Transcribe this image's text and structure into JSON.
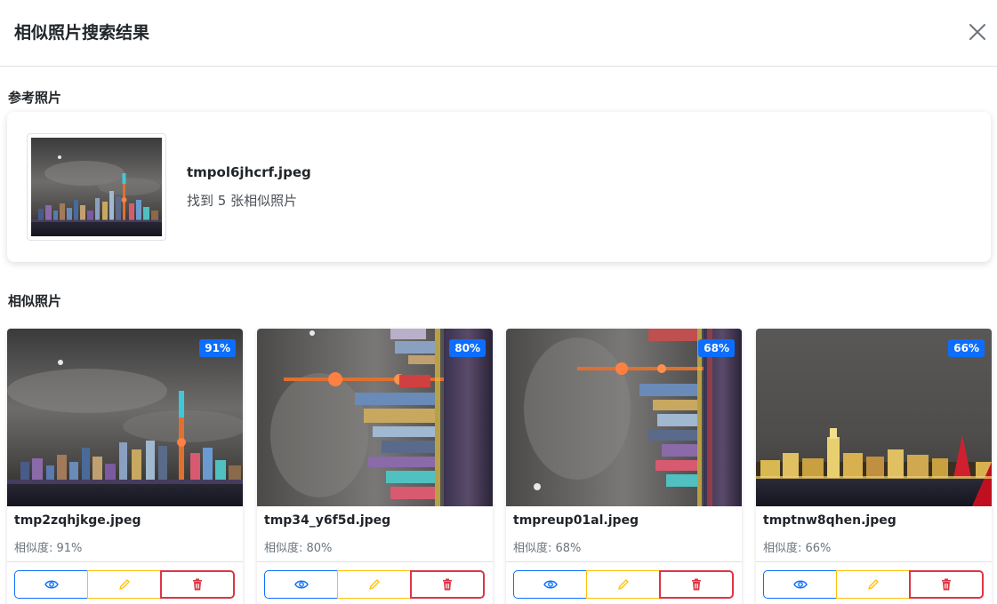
{
  "modal": {
    "title": "相似照片搜索结果",
    "close_icon": "close-icon"
  },
  "reference": {
    "section_title": "参考照片",
    "filename": "tmpol6jhcrf.jpeg",
    "count_text": "找到 5 张相似照片"
  },
  "similar": {
    "section_title": "相似照片",
    "items": [
      {
        "filename": "tmp2zqhjkge.jpeg",
        "badge": "91%",
        "similarity": "相似度: 91%"
      },
      {
        "filename": "tmp34_y6f5d.jpeg",
        "badge": "80%",
        "similarity": "相似度: 80%"
      },
      {
        "filename": "tmpreup01al.jpeg",
        "badge": "68%",
        "similarity": "相似度: 68%"
      },
      {
        "filename": "tmptnw8qhen.jpeg",
        "badge": "66%",
        "similarity": "相似度: 66%"
      }
    ],
    "actions": {
      "view_icon": "eye-icon",
      "edit_icon": "pencil-icon",
      "delete_icon": "trash-icon"
    }
  },
  "colors": {
    "primary": "#0d6efd",
    "warning": "#ffc107",
    "danger": "#dc3545",
    "border": "#dee2e6"
  }
}
